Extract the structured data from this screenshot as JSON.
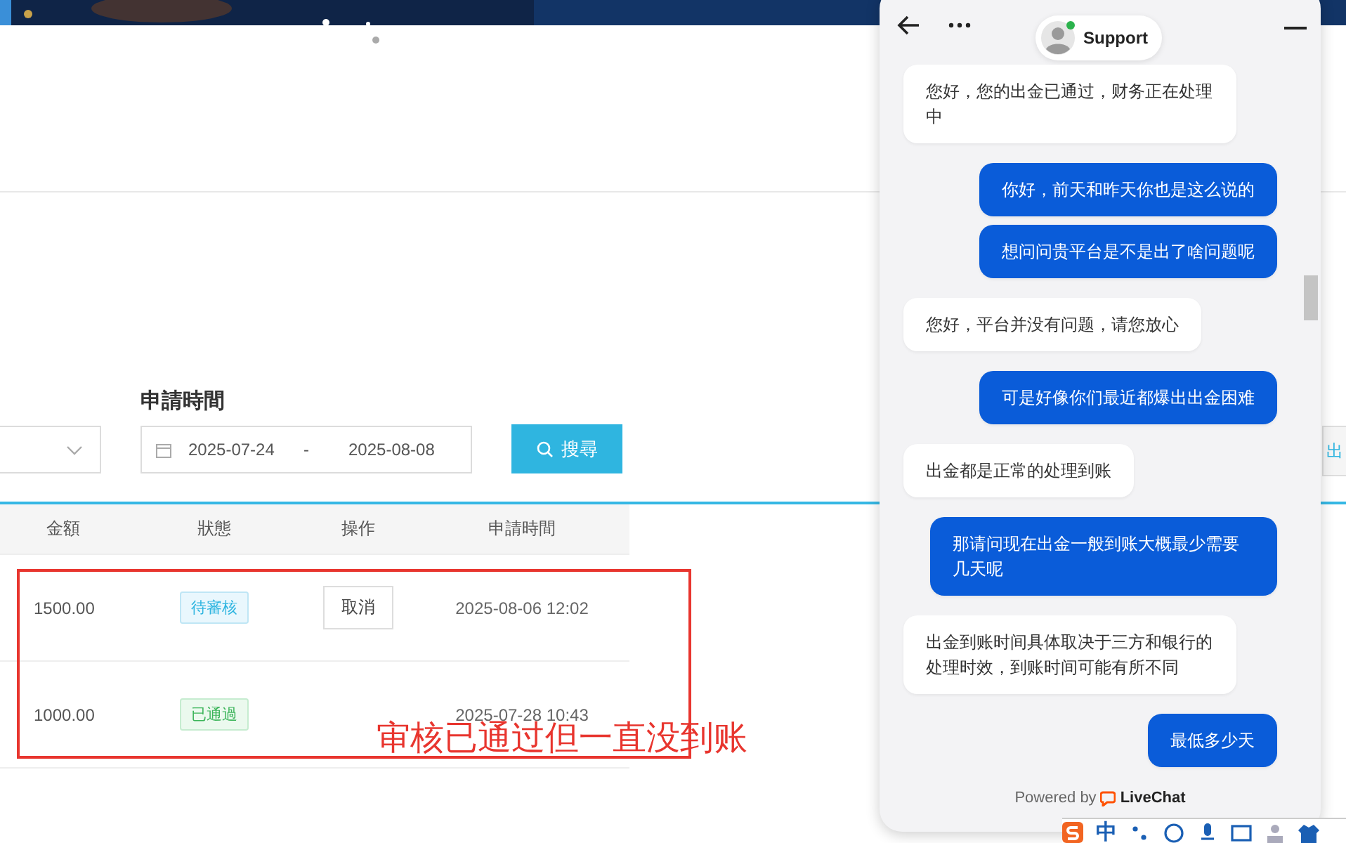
{
  "filters": {
    "date_label": "申請時間",
    "date_start": "2025-07-24",
    "date_separator": "-",
    "date_end": "2025-08-08",
    "search_button": "搜尋"
  },
  "edge_button": "出",
  "table": {
    "columns": [
      "金額",
      "狀態",
      "操作",
      "申請時間"
    ],
    "rows": [
      {
        "amount": "1500.00",
        "status": {
          "label": "待審核",
          "kind": "pending"
        },
        "action": "取消",
        "time": "2025-08-06 12:02"
      },
      {
        "amount": "1000.00",
        "status": {
          "label": "已通過",
          "kind": "approved"
        },
        "time": "2025-07-28 10:43"
      }
    ]
  },
  "annotation": {
    "text": "审核已通过但一直没到账"
  },
  "chat": {
    "agent": {
      "name": "Support",
      "online": true
    },
    "messages": [
      {
        "kind": "received",
        "text": "您好，您的出金已通过，财务正在处理中"
      },
      {
        "kind": "sent",
        "text": "你好，前天和昨天你也是这么说的"
      },
      {
        "kind": "sent",
        "text": "想问问贵平台是不是出了啥问题呢"
      },
      {
        "kind": "received",
        "text": "您好，平台并没有问题，请您放心"
      },
      {
        "kind": "sent",
        "text": "可是好像你们最近都爆出出金困难"
      },
      {
        "kind": "received",
        "text": "出金都是正常的处理到账"
      },
      {
        "kind": "sent",
        "text": "那请问现在出金一般到账大概最少需要几天呢"
      },
      {
        "kind": "received",
        "text": "出金到账时间具体取决于三方和银行的处理时效，到账时间可能有所不同"
      },
      {
        "kind": "sent",
        "text": "最低多少天"
      }
    ],
    "footer": {
      "prefix": "Powered by",
      "brand": "LiveChat"
    }
  },
  "ime_toolbar": {
    "mode": "中"
  }
}
